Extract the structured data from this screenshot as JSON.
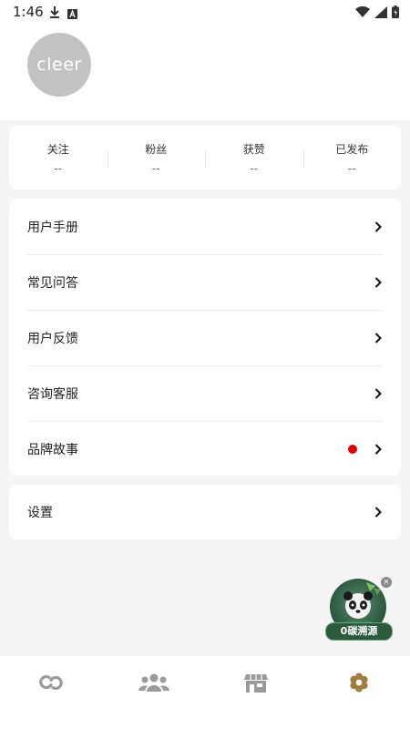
{
  "status_bar": {
    "time": "1:46",
    "icons": [
      "download-icon",
      "a-badge-icon",
      "wifi-icon",
      "signal-icon",
      "battery-icon"
    ]
  },
  "profile": {
    "avatar_text": "cleer"
  },
  "stats": [
    {
      "label": "关注",
      "value": "--"
    },
    {
      "label": "粉丝",
      "value": "--"
    },
    {
      "label": "获赞",
      "value": "--"
    },
    {
      "label": "已发布",
      "value": "--"
    }
  ],
  "menu": [
    {
      "label": "用户手册",
      "badge": false
    },
    {
      "label": "常见问答",
      "badge": false
    },
    {
      "label": "用户反馈",
      "badge": false
    },
    {
      "label": "咨询客服",
      "badge": false
    },
    {
      "label": "品牌故事",
      "badge": true
    }
  ],
  "settings": {
    "label": "设置"
  },
  "floating_badge": {
    "label": "0碳溯源"
  },
  "bottom_nav": [
    {
      "icon": "link-icon",
      "active": false
    },
    {
      "icon": "community-icon",
      "active": false
    },
    {
      "icon": "store-icon",
      "active": false
    },
    {
      "icon": "gear-icon",
      "active": true
    }
  ],
  "colors": {
    "active_nav": "#a07d3e",
    "inactive_nav": "#9a9a9a",
    "badge_dot": "#e60000",
    "page_bg": "#f5f5f5"
  }
}
